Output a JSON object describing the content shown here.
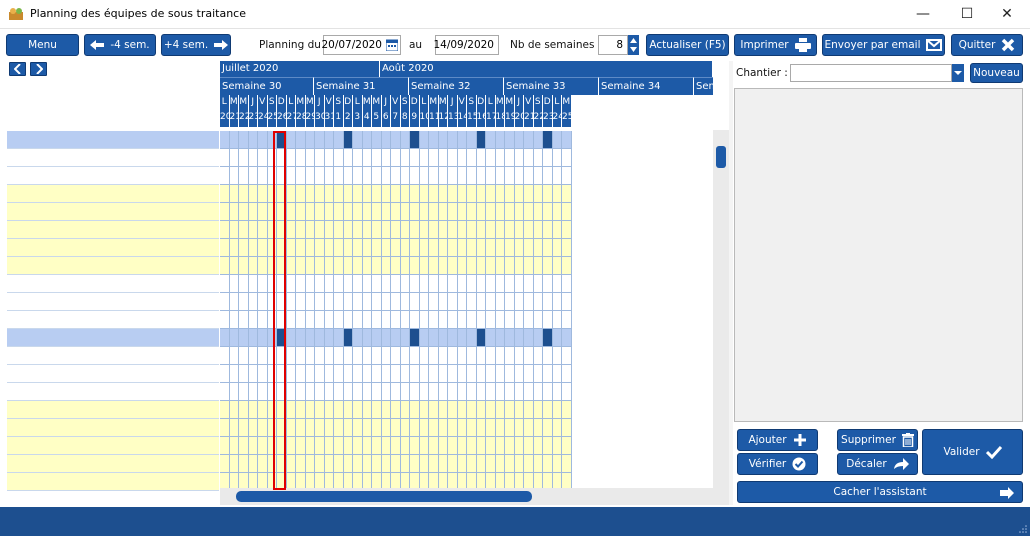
{
  "window": {
    "title": "Planning des équipes de sous traitance",
    "minimize": "—",
    "maximize": "☐",
    "close": "✕"
  },
  "toolbar": {
    "menu": "Menu",
    "minus4": "-4 sem.",
    "plus4": "+4 sem.",
    "planning_du_label": "Planning du",
    "date_from": "20/07/2020",
    "au_label": "au",
    "date_to": "14/09/2020",
    "nb_semaines_label": "Nb de semaines :",
    "nb_semaines": "8",
    "actualiser": "Actualiser (F5)",
    "imprimer": "Imprimer",
    "envoyer": "Envoyer par email",
    "quitter": "Quitter"
  },
  "grid": {
    "months": [
      "Juillet 2020",
      "Août 2020"
    ],
    "weeks": [
      "Semaine 30",
      "Semaine 31",
      "Semaine 32",
      "Semaine 33",
      "Semaine 34",
      "Sem"
    ],
    "day_letters": [
      "L",
      "M",
      "M",
      "J",
      "V",
      "S",
      "D"
    ],
    "day_numbers": [
      20,
      21,
      22,
      23,
      24,
      25,
      26,
      27,
      28,
      29,
      30,
      31,
      1,
      2,
      3,
      4,
      5,
      6,
      7,
      8,
      9,
      10,
      11,
      12,
      13,
      14,
      15,
      16,
      17,
      18,
      19,
      20,
      21,
      22,
      23,
      24,
      25
    ],
    "row_colors": [
      "blue",
      "white",
      "white",
      "yellow",
      "yellow",
      "yellow",
      "yellow",
      "yellow",
      "white",
      "white",
      "white",
      "blue",
      "white",
      "white",
      "white",
      "yellow",
      "yellow",
      "yellow",
      "yellow",
      "yellow"
    ],
    "highlight_day_index": 4
  },
  "assistant": {
    "chantier_label": "Chantier :",
    "chantier_value": "",
    "nouveau": "Nouveau",
    "ajouter": "Ajouter",
    "supprimer": "Supprimer",
    "valider": "Valider",
    "verifier": "Vérifier",
    "decaler": "Décaler",
    "cacher": "Cacher l'assistant"
  },
  "colors": {
    "accent": "#1d5aa7",
    "yellow_row": "#ffffc5",
    "blue_row": "#b8cdf2",
    "sunday_cell": "#1d4f8f",
    "highlight": "#e00000"
  }
}
